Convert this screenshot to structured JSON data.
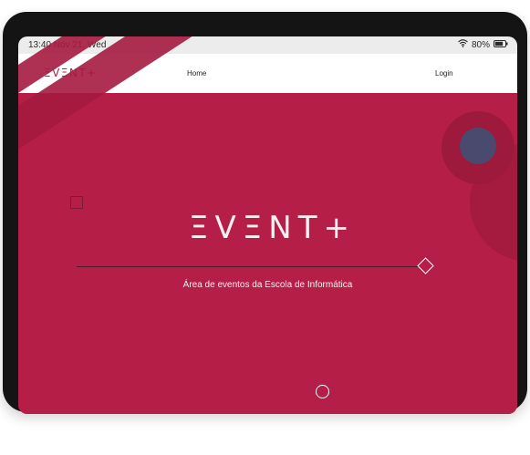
{
  "status_bar": {
    "time_date": "13:40  Nov 21. Wed",
    "wifi_icon": "wifi-icon",
    "battery_percent": "80%",
    "battery_icon": "battery-icon",
    "battery_level": 0.8
  },
  "navbar": {
    "logo_text": "ΞVΞNT+",
    "home_label": "Home",
    "login_label": "Login"
  },
  "hero": {
    "title": "ΞVΞNT+",
    "subtitle": "Área de eventos da Escola de Informática",
    "scroll_indicator_icon": "circle-icon",
    "diamond_icon": "diamond-icon"
  },
  "colors": {
    "brand": "#b51e46",
    "brand_dark": "#a51a3f",
    "accent_navy": "#4a4a6f",
    "frame": "#141414",
    "statusbar_bg": "#ececec",
    "navbar_bg": "#ffffff"
  }
}
